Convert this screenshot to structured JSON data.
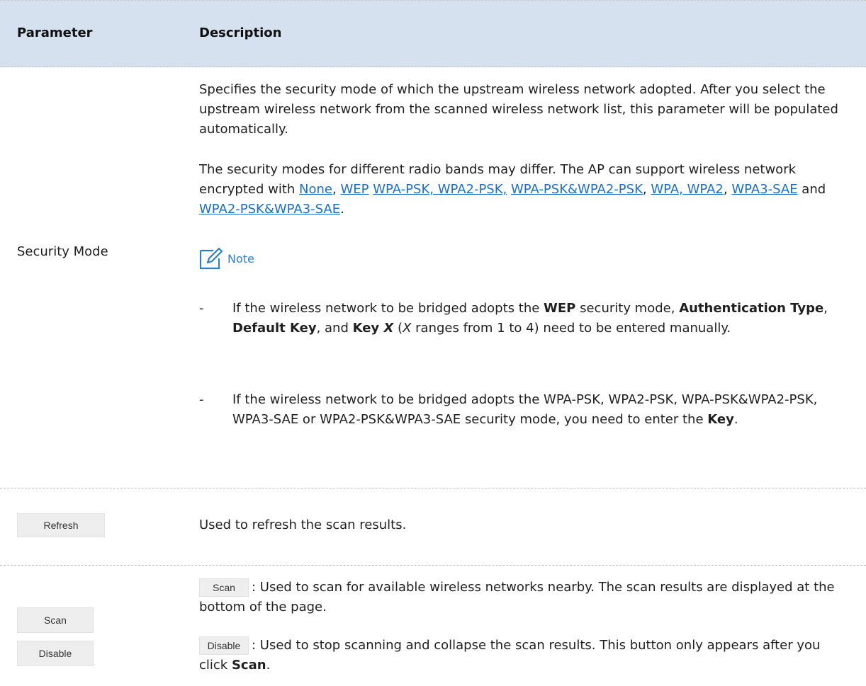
{
  "table": {
    "headers": {
      "parameter": "Parameter",
      "description": "Description"
    },
    "security_mode": {
      "parameter": "Security Mode",
      "para1": "Specifies the security mode of which the upstream wireless network adopted. After you select the upstream wireless network from the scanned wireless network list, this parameter will be populated automatically.",
      "para2_intro": "The security modes for different radio bands may differ. The AP can support wireless network encrypted with ",
      "links": [
        "None",
        "WEP",
        "WPA-PSK, WPA2-PSK,",
        "WPA-PSK&WPA2-PSK",
        "WPA, WPA2",
        "WPA3-SAE",
        "WPA2-PSK&WPA3-SAE"
      ],
      "sep_comma": ",",
      "sep_space": " ",
      "sep_and": " and ",
      "period": ".",
      "note_label": "Note",
      "note_icon": "note-pencil-icon",
      "bullet_dash": "-",
      "bullet1": {
        "t1": "If the wireless network to be bridged adopts the ",
        "b1": "WEP",
        "t2": " security mode, ",
        "b2": "Authentication Type",
        "t3": ", ",
        "b3": "Default Key",
        "t4": ", and ",
        "b4": "Key ",
        "bi": "X",
        "t5": " (",
        "i1": "X",
        "t6": " ranges from 1 to 4) need to be entered manually."
      },
      "bullet2": {
        "t1": "If the wireless network to be bridged adopts the WPA-PSK, WPA2-PSK, WPA-PSK&WPA2-PSK, WPA3-SAE or WPA2-PSK&WPA3-SAE security mode, you need to enter the ",
        "b1": "Key",
        "t2": "."
      }
    },
    "refresh": {
      "button_label": "Refresh",
      "description": "Used to refresh the scan results."
    },
    "scan_disable": {
      "scan_label": "Scan",
      "disable_label": "Disable",
      "scan_desc": ": Used to scan for available wireless networks nearby. The scan results are displayed at the bottom of the page.",
      "disable_desc_1": ": Used to stop scanning and collapse the scan results. This button only appears after you click ",
      "disable_desc_bold": "Scan",
      "disable_desc_2": "."
    }
  },
  "colors": {
    "header_bg": "#d5e1ee",
    "link": "#1a6fc9",
    "note": "#2f7fc8",
    "button_bg": "#eeeeee"
  }
}
